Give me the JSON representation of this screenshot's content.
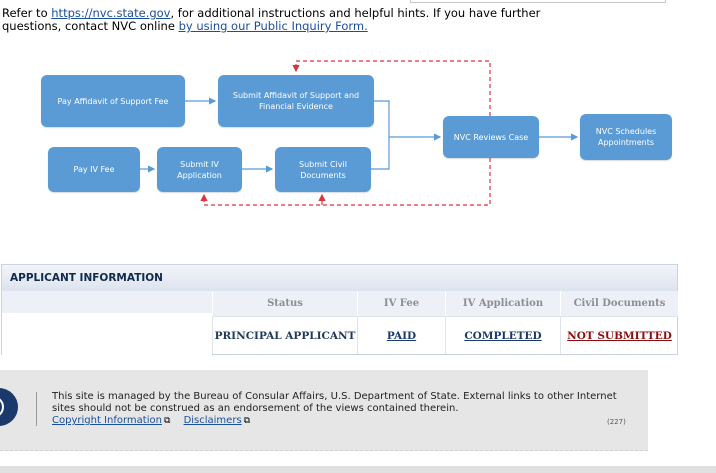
{
  "intro": {
    "text_before": "Refer to ",
    "link1": "https://nvc.state.gov",
    "text_middle": ", for additional instructions and helpful hints. If you have further questions, contact NVC online ",
    "link2": "by using our Public Inquiry Form."
  },
  "flow": {
    "pay_affidavit": "Pay Affidavit of Support Fee",
    "submit_affidavit": "Submit Affidavit of Support and Financial Evidence",
    "pay_iv": "Pay IV Fee",
    "submit_iv": "Submit IV Application",
    "submit_civil": "Submit Civil Documents",
    "nvc_reviews": "NVC Reviews Case",
    "nvc_schedules": "NVC Schedules Appointments"
  },
  "applicant": {
    "header": "APPLICANT INFORMATION",
    "columns": {
      "status": "Status",
      "iv_fee": "IV Fee",
      "iv_application": "IV Application",
      "civil_documents": "Civil Documents"
    },
    "row": {
      "status": "PRINCIPAL APPLICANT",
      "iv_fee": "PAID",
      "iv_application": "COMPLETED",
      "civil_documents": "NOT SUBMITTED"
    }
  },
  "footer": {
    "text": "This site is managed by the Bureau of Consular Affairs, U.S. Department of State. External links to other Internet sites should not be construed as an endorsement of the views contained therein.",
    "copyright": "Copyright Information",
    "disclaimers": "Disclaimers",
    "page_code": "(227)"
  },
  "colors": {
    "box": "#5b9bd5",
    "arrow": "#5b9bd5",
    "return": "#d9363e",
    "not_submitted": "#8b0d0d"
  }
}
